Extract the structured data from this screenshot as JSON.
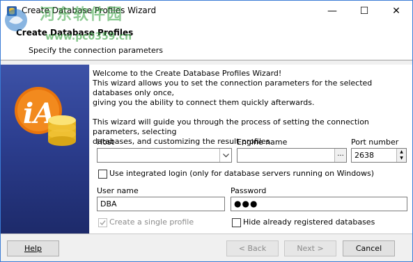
{
  "window": {
    "title": "Create Database Profiles Wizard",
    "minimize_glyph": "—",
    "maximize_glyph": "☐",
    "close_glyph": "✕"
  },
  "watermark": {
    "text": "河东软件园",
    "url": "www.pc0359.cn"
  },
  "header": {
    "title": "Create Database Profiles",
    "subtitle": "Specify the connection parameters"
  },
  "intro": {
    "line1": "Welcome to the Create Database Profiles Wizard!",
    "line2": "This wizard allows you to set the connection parameters for the selected databases only once,",
    "line3": "giving you the ability to connect them quickly afterwards.",
    "line4": "This wizard will guide you through the process of setting the connection parameters, selecting",
    "line5": "databases, and customizing the result profiles."
  },
  "form": {
    "host_label": "Host",
    "host_value": "",
    "engine_label": "Engine name",
    "engine_value": "",
    "engine_button": "...",
    "port_label": "Port number",
    "port_value": "2638",
    "integrated_login_label": "Use integrated login (only for database servers running on Windows)",
    "integrated_login_checked": false,
    "username_label": "User name",
    "username_value": "DBA",
    "password_label": "Password",
    "password_value": "●●●",
    "single_profile_label": "Create a single profile",
    "single_profile_checked": true,
    "hide_registered_label": "Hide already registered databases",
    "hide_registered_checked": false
  },
  "buttons": {
    "help": "Help",
    "back": "< Back",
    "next": "Next >",
    "cancel": "Cancel"
  },
  "colors": {
    "banner_top": "#3d52a7",
    "banner_bottom": "#1d2a6a",
    "logo_orange": "#e8740c",
    "db_gold": "#f2c200"
  },
  "icons": {
    "app": "database-wizard-icon",
    "combo": "chevron-down-icon",
    "logo": "ia-logo",
    "database": "database-icon"
  }
}
